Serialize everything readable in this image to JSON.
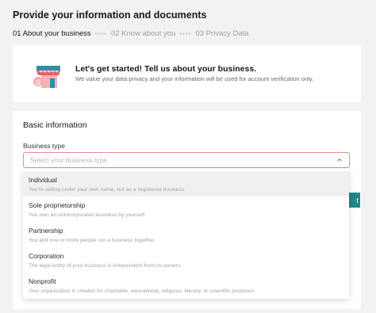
{
  "page": {
    "title": "Provide your information and documents"
  },
  "steps": [
    {
      "label": "01 About your business",
      "active": true
    },
    {
      "label": "02 Know about you",
      "active": false
    },
    {
      "label": "03 Privacy Data",
      "active": false
    }
  ],
  "steps_separator": "••••",
  "intro": {
    "icon": "storefront-icon",
    "title": "Let's get started! Tell us about your business.",
    "subtitle": "We value your data privacy and your information will be used for account verification only."
  },
  "basic_info": {
    "section_title": "Basic information",
    "business_type": {
      "label": "Business type",
      "placeholder": "Select your business type",
      "icon": "chevron-up-icon"
    }
  },
  "next_button": {
    "label": "t"
  },
  "dropdown": {
    "options": [
      {
        "title": "Individual",
        "description": "You're selling under your own name, not as a registered business.",
        "selected": true
      },
      {
        "title": "Sole proprietorship",
        "description": "You own an unincorporated business by yourself.",
        "selected": false
      },
      {
        "title": "Partnership",
        "description": "You and one or more people run a business together.",
        "selected": false
      },
      {
        "title": "Corporation",
        "description": "The legal entity of your business is independent from its owners.",
        "selected": false
      },
      {
        "title": "Nonprofit",
        "description": "Your organization is created for charitable, educational, religious, literary, or scientific purposes.",
        "selected": false
      }
    ]
  },
  "colors": {
    "accent": "#1b8a86",
    "select_border_error": "#e98a8f",
    "selected_option_bg": "#f0f0f1"
  }
}
